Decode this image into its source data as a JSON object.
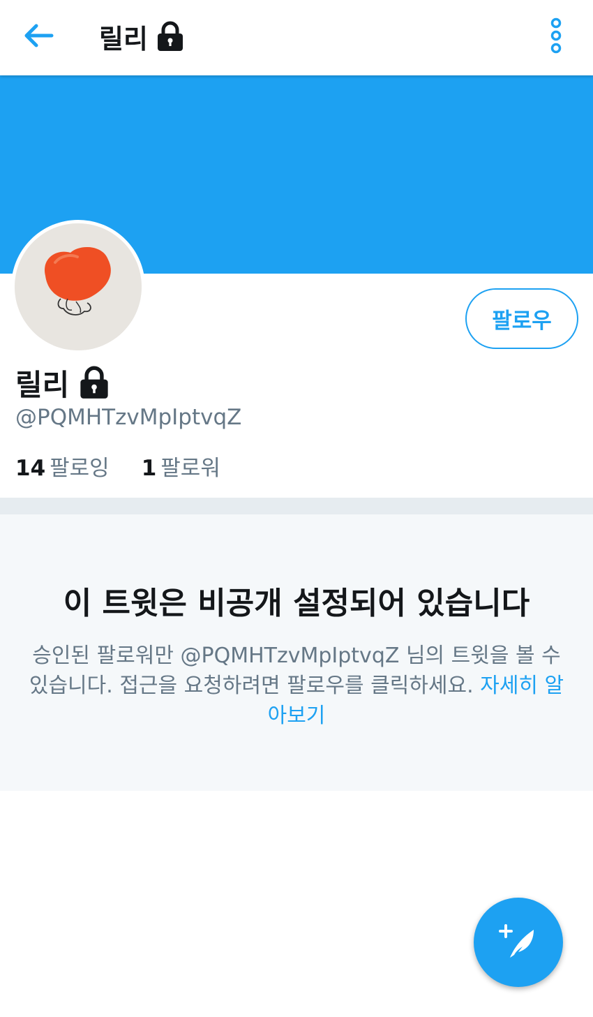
{
  "header": {
    "back_icon": "arrow-left-icon",
    "title": "릴리",
    "lock_icon": "lock-icon",
    "more_icon": "more-vertical-icon"
  },
  "profile": {
    "display_name": "릴리",
    "handle": "@PQMHTzvMpIptvqZ",
    "follow_button": "팔로우",
    "following_count": "14",
    "following_label": "팔로잉",
    "followers_count": "1",
    "followers_label": "팔로워"
  },
  "protected": {
    "title": "이 트윗은 비공개 설정되어 있습니다",
    "description": "승인된 팔로워만 @PQMHTzvMpIptvqZ 님의 트윗을 볼 수 있습니다. 접근을 요청하려면 팔로우를 클릭하세요.",
    "learn_more": "자세히 알아보기"
  },
  "compose_button": {
    "icon": "compose-tweet-icon"
  },
  "colors": {
    "accent": "#1da1f2",
    "text": "#14171a",
    "secondary": "#657786",
    "panel": "#f5f8fa"
  }
}
